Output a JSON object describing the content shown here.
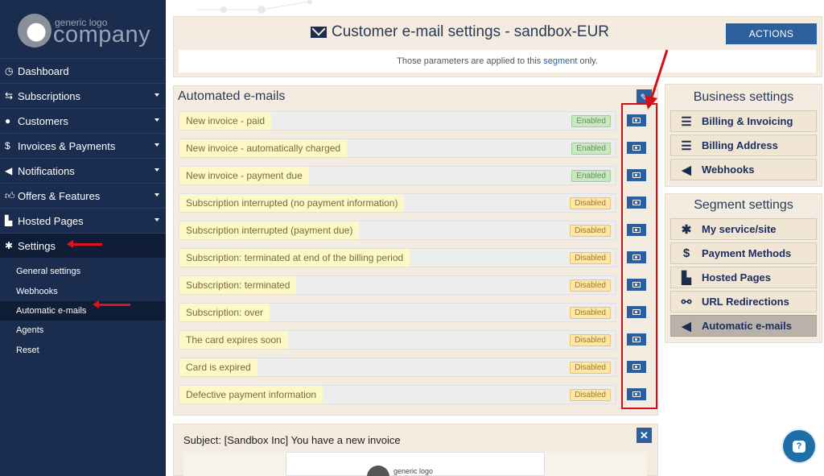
{
  "logo": {
    "small": "generic logo",
    "big": "company"
  },
  "sidebar": {
    "items": [
      {
        "label": "Dashboard",
        "icon": "dashboard-icon",
        "caret": false
      },
      {
        "label": "Subscriptions",
        "icon": "subscriptions-icon",
        "caret": true
      },
      {
        "label": "Customers",
        "icon": "user-icon",
        "caret": true
      },
      {
        "label": "Invoices & Payments",
        "icon": "dollar-icon",
        "caret": true
      },
      {
        "label": "Notifications",
        "icon": "megaphone-icon",
        "caret": true
      },
      {
        "label": "Offers & Features",
        "icon": "thumbs-up-icon",
        "caret": true
      },
      {
        "label": "Hosted Pages",
        "icon": "cart-icon",
        "caret": true
      },
      {
        "label": "Settings",
        "icon": "gear-icon",
        "caret": false,
        "active": true
      }
    ],
    "sub_items": [
      {
        "label": "General settings"
      },
      {
        "label": "Webhooks"
      },
      {
        "label": "Automatic e-mails",
        "active": true
      },
      {
        "label": "Agents"
      },
      {
        "label": "Reset"
      }
    ]
  },
  "header": {
    "title_prefix": "Customer e-mail settings -",
    "title_env": "sandbox-EUR",
    "actions_label": "ACTIONS",
    "note_before": "Those parameters are applied to this",
    "note_link": "segment",
    "note_after": "only."
  },
  "emails": {
    "title": "Automated e-mails",
    "rows": [
      {
        "label": "New invoice - paid",
        "status": "Enabled"
      },
      {
        "label": "New invoice - automatically charged",
        "status": "Enabled"
      },
      {
        "label": "New invoice - payment due",
        "status": "Enabled"
      },
      {
        "label": "Subscription interrupted (no payment information)",
        "status": "Disabled"
      },
      {
        "label": "Subscription interrupted (payment due)",
        "status": "Disabled"
      },
      {
        "label": "Subscription: terminated at end of the billing period",
        "status": "Disabled"
      },
      {
        "label": "Subscription: terminated",
        "status": "Disabled"
      },
      {
        "label": "Subscription: over",
        "status": "Disabled"
      },
      {
        "label": "The card expires soon",
        "status": "Disabled"
      },
      {
        "label": "Card is expired",
        "status": "Disabled"
      },
      {
        "label": "Defective payment information",
        "status": "Disabled"
      }
    ]
  },
  "subject": {
    "text": "Subject: [Sandbox Inc] You have a new invoice",
    "preview_logo": "generic logo"
  },
  "business_settings": {
    "title": "Business settings",
    "items": [
      {
        "label": "Billing & Invoicing",
        "icon": "list-icon"
      },
      {
        "label": "Billing Address",
        "icon": "list-icon"
      },
      {
        "label": "Webhooks",
        "icon": "megaphone-icon"
      }
    ]
  },
  "segment_settings": {
    "title": "Segment settings",
    "items": [
      {
        "label": "My service/site",
        "icon": "gear-icon"
      },
      {
        "label": "Payment Methods",
        "icon": "dollar-icon"
      },
      {
        "label": "Hosted Pages",
        "icon": "cart-icon"
      },
      {
        "label": "URL Redirections",
        "icon": "link-icon"
      },
      {
        "label": "Automatic e-mails",
        "icon": "megaphone-icon",
        "active": true
      }
    ]
  },
  "colors": {
    "sidebar": "#1b2d4f",
    "accent": "#2c5f9e",
    "panel": "#f4ece0",
    "enabled": "#c9e7c0",
    "disabled": "#ffe6a6",
    "annotation": "#e0121c"
  }
}
